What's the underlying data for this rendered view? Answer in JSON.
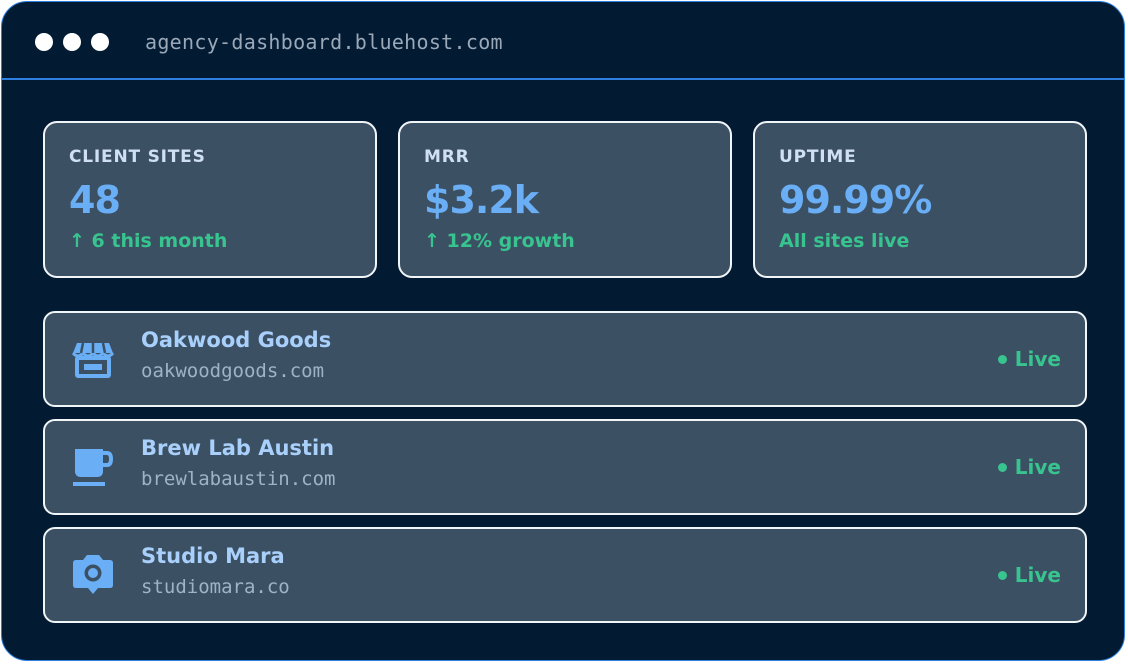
{
  "window": {
    "url": "agency-dashboard.bluehost.com"
  },
  "stats": [
    {
      "label": "CLIENT SITES",
      "value": "48",
      "sub": "↑ 6 this month"
    },
    {
      "label": "MRR",
      "value": "$3.2k",
      "sub": "↑ 12% growth"
    },
    {
      "label": "UPTIME",
      "value": "99.99%",
      "sub": "All sites live"
    }
  ],
  "sites": [
    {
      "name": "Oakwood Goods",
      "domain": "oakwoodgoods.com",
      "status": "Live",
      "icon": "storefront-icon"
    },
    {
      "name": "Brew Lab Austin",
      "domain": "brewlabaustin.com",
      "status": "Live",
      "icon": "coffee-cup-icon"
    },
    {
      "name": "Studio Mara",
      "domain": "studiomara.co",
      "status": "Live",
      "icon": "camera-icon"
    }
  ],
  "colors": {
    "background": "#021b33",
    "card": "#3c5064",
    "accent": "#6aaef5",
    "success": "#37c48e",
    "border": "#2f7fe0"
  }
}
